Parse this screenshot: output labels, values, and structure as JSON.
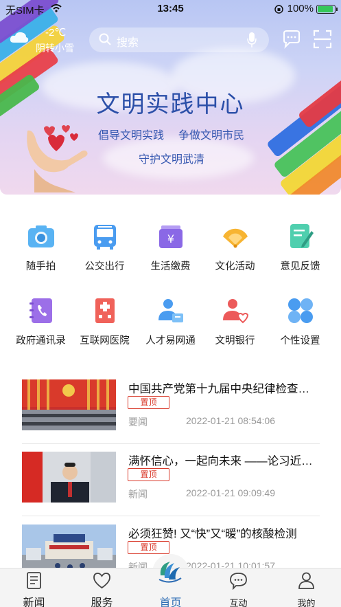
{
  "status_bar": {
    "carrier": "无SIM卡",
    "time": "13:45",
    "battery": "100%"
  },
  "header": {
    "weather_temp": "-2℃",
    "weather_desc": "阴转小雪",
    "search_placeholder": "搜索"
  },
  "banner": {
    "title": "文明实践中心",
    "slogan_1": "倡导文明实践",
    "slogan_2": "争做文明市民",
    "slogan_3": "守护文明武清"
  },
  "services": [
    {
      "label": "随手拍",
      "icon": "camera-icon"
    },
    {
      "label": "公交出行",
      "icon": "bus-icon"
    },
    {
      "label": "生活缴费",
      "icon": "wallet-icon"
    },
    {
      "label": "文化活动",
      "icon": "fan-icon"
    },
    {
      "label": "意见反馈",
      "icon": "feedback-icon"
    },
    {
      "label": "政府通讯录",
      "icon": "phonebook-icon"
    },
    {
      "label": "互联网医院",
      "icon": "hospital-icon"
    },
    {
      "label": "人才易网通",
      "icon": "talent-icon"
    },
    {
      "label": "文明银行",
      "icon": "bank-heart-icon"
    },
    {
      "label": "个性设置",
      "icon": "settings-grid-icon"
    }
  ],
  "news": [
    {
      "title": "中国共产党第十九届中央纪律检查委员会第六次全体会议",
      "pin": "置顶",
      "category": "要闻",
      "time": "2022-01-21 08:54:06"
    },
    {
      "title": "满怀信心，一起向未来 ——论习近平主席",
      "pin": "置顶",
      "category": "新闻",
      "time": "2022-01-21 09:09:49"
    },
    {
      "title": "必须狂赞! 又“快”又“暖”的核酸检测",
      "pin": "置顶",
      "category": "新闻",
      "time": "2022-01-21 10:01:57"
    }
  ],
  "tabbar": {
    "news": "新闻",
    "service": "服务",
    "home": "首页",
    "interact": "互动",
    "mine": "我的"
  },
  "colors": {
    "accent": "#2e6db4",
    "pin_red": "#d93a2b",
    "banner_title": "#2b4fa8"
  }
}
